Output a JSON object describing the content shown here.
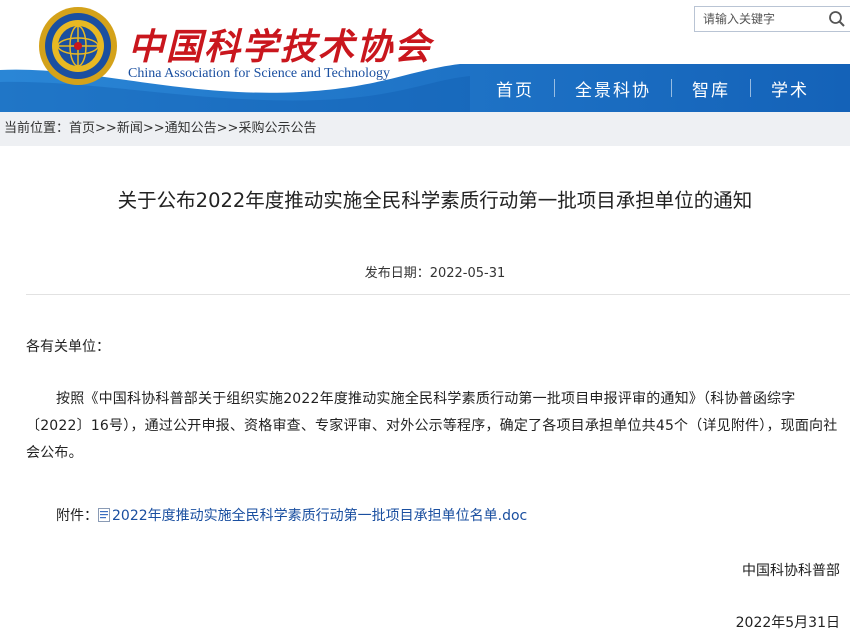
{
  "header": {
    "logo_cn": "中国科学技术协会",
    "logo_en": "China Association for Science and Technology",
    "search_placeholder": "请输入关键字",
    "nav": [
      "首页",
      "全景科协",
      "智库",
      "学术"
    ]
  },
  "breadcrumb": {
    "prefix": "当前位置：",
    "items": [
      "首页",
      "新闻",
      "通知公告",
      "采购公示公告"
    ],
    "separator": ">>"
  },
  "article": {
    "title": "关于公布2022年度推动实施全民科学素质行动第一批项目承担单位的通知",
    "date_label": "发布日期：",
    "date": "2022-05-31",
    "salutation": "各有关单位：",
    "body": "按照《中国科协科普部关于组织实施2022年度推动实施全民科学素质行动第一批项目申报评审的通知》（科协普函综字〔2022〕16号），通过公开申报、资格审查、专家评审、对外公示等程序，确定了各项目承担单位共45个（详见附件），现面向社会公布。",
    "attachment_label": "附件：",
    "attachment_link": "2022年度推动实施全民科学素质行动第一批项目承担单位名单.doc",
    "signature": "中国科协科普部",
    "sign_date": "2022年5月31日"
  },
  "colors": {
    "nav_blue": "#1e6fc6",
    "logo_red": "#c9161d",
    "link_blue": "#1a4fa0",
    "breadcrumb_bg": "#eef0f3"
  }
}
